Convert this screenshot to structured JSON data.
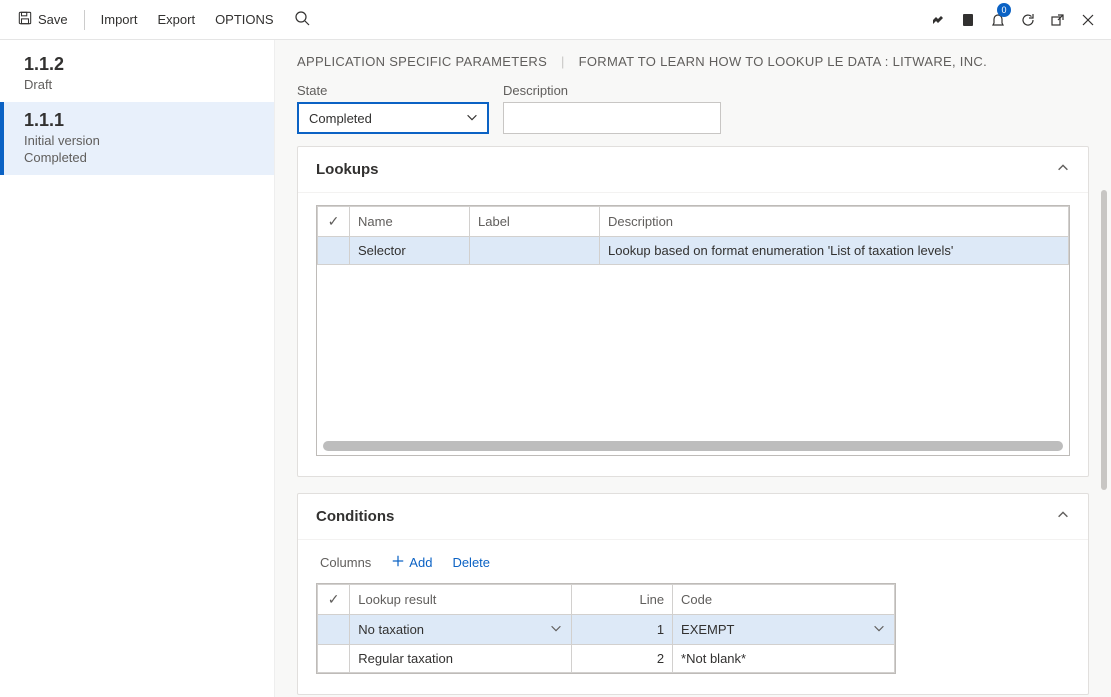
{
  "toolbar": {
    "save": "Save",
    "import": "Import",
    "export": "Export",
    "options": "OPTIONS",
    "notifications": "0"
  },
  "sidebar": {
    "items": [
      {
        "version": "1.1.2",
        "line1": "Draft",
        "line2": ""
      },
      {
        "version": "1.1.1",
        "line1": "Initial version",
        "line2": "Completed"
      }
    ],
    "selectedIndex": 1
  },
  "breadcrumb": {
    "left": "APPLICATION SPECIFIC PARAMETERS",
    "right": "FORMAT TO LEARN HOW TO LOOKUP LE DATA : LITWARE, INC."
  },
  "fields": {
    "state_label": "State",
    "state_value": "Completed",
    "desc_label": "Description",
    "desc_value": ""
  },
  "lookups": {
    "title": "Lookups",
    "headers": {
      "name": "Name",
      "label": "Label",
      "description": "Description"
    },
    "rows": [
      {
        "name": "Selector",
        "label": "",
        "description": "Lookup based on format enumeration 'List of taxation levels'"
      }
    ]
  },
  "conditions": {
    "title": "Conditions",
    "toolbar": {
      "columns": "Columns",
      "add": "Add",
      "delete": "Delete"
    },
    "headers": {
      "result": "Lookup result",
      "line": "Line",
      "code": "Code"
    },
    "rows": [
      {
        "result": "No taxation",
        "line": "1",
        "code": "EXEMPT"
      },
      {
        "result": "Regular taxation",
        "line": "2",
        "code": "*Not blank*"
      }
    ],
    "selectedIndex": 0
  }
}
